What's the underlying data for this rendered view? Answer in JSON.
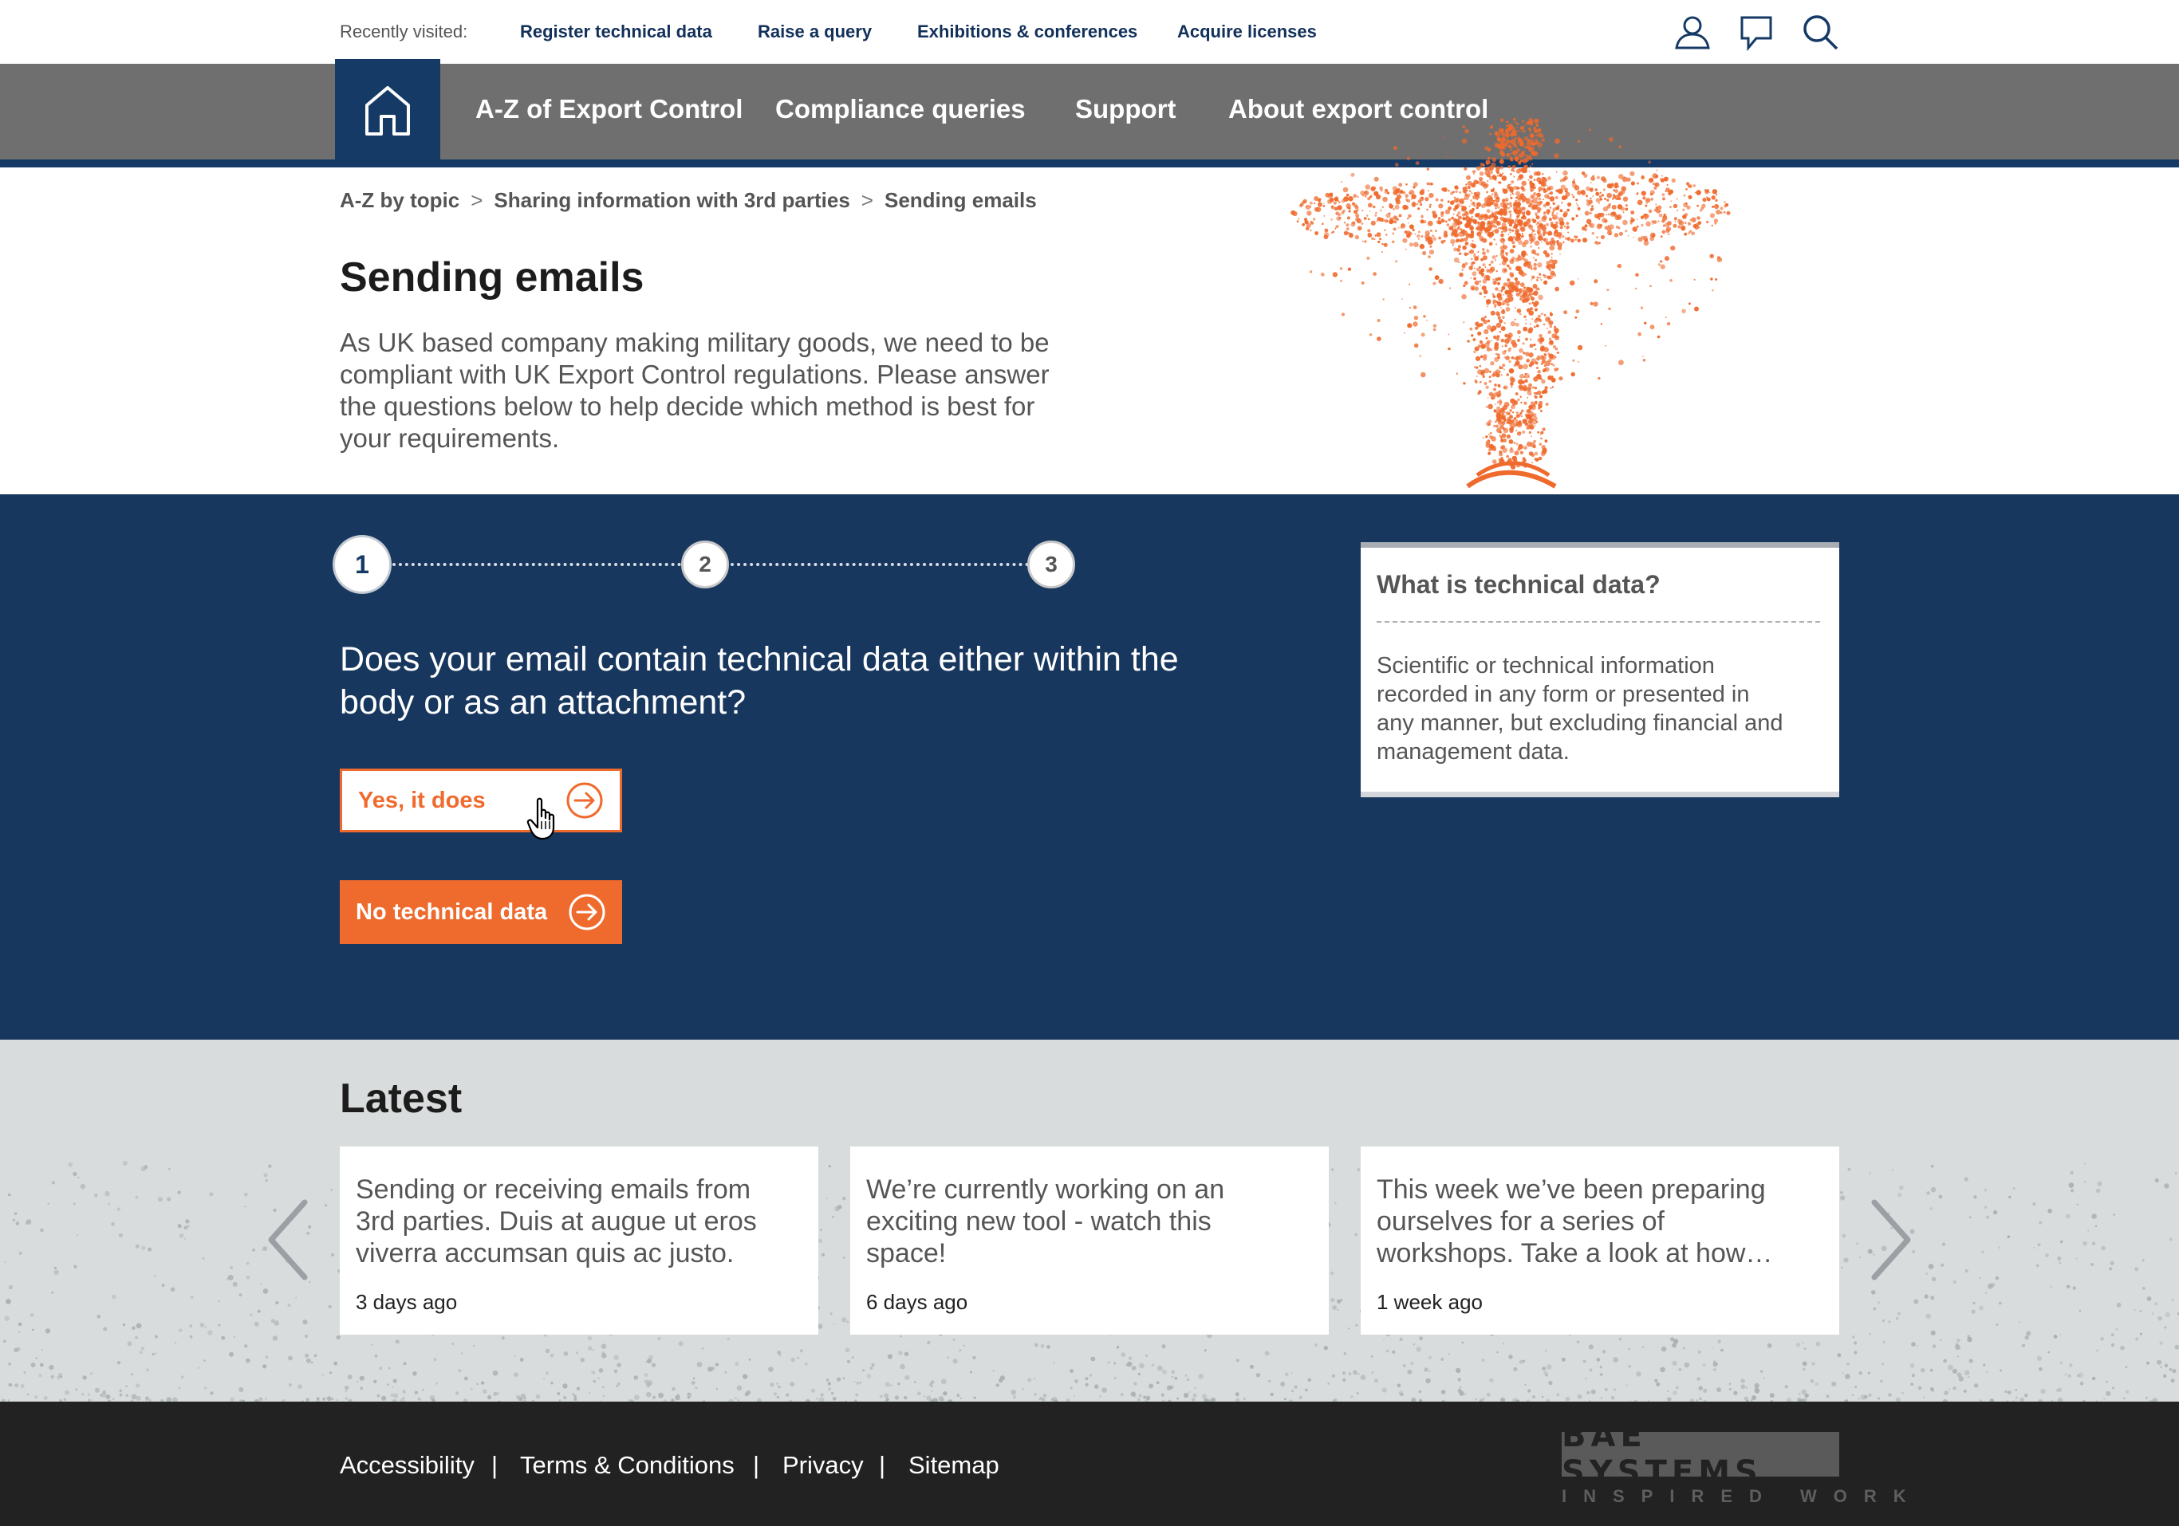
{
  "topbar": {
    "recently_visited_label": "Recently visited:",
    "links": [
      "Register technical data",
      "Raise a query",
      "Exhibitions & conferences",
      "Acquire licenses"
    ],
    "icons": [
      "user-icon",
      "feedback-icon",
      "search-icon"
    ]
  },
  "nav": {
    "home_icon": "home-icon",
    "items": [
      "A-Z of Export Control",
      "Compliance queries",
      "Support",
      "About export control"
    ]
  },
  "breadcrumb": {
    "items": [
      "A-Z by topic",
      "Sharing information with 3rd parties",
      "Sending emails"
    ],
    "separator": ">"
  },
  "hero": {
    "title": "Sending emails",
    "intro": "As UK based company making military goods, we need to be compliant with UK Export Control regulations. Please answer the questions below to help decide which method is best for your requirements."
  },
  "stepper": {
    "steps": [
      "1",
      "2",
      "3"
    ],
    "current_step": 1
  },
  "question": {
    "text": "Does your email contain technical data either within the body or as an attachment?",
    "answers": [
      "Yes, it does",
      "No technical data"
    ]
  },
  "info_card": {
    "title": "What is technical data?",
    "body": "Scientific or technical information recorded in any form or presented in any manner, but excluding financial and management data."
  },
  "latest": {
    "title": "Latest",
    "cards": [
      {
        "text": "Sending or receiving emails from 3rd parties. Duis at augue ut eros viverra accumsan quis ac justo.",
        "time": "3 days ago"
      },
      {
        "text": "We’re currently working on an exciting new tool - watch this space!",
        "time": "6 days ago"
      },
      {
        "text": "This week we’ve been preparing ourselves for a series of workshops. Take a look at how…",
        "time": "1 week ago"
      }
    ]
  },
  "footer": {
    "links": [
      "Accessibility",
      "Terms & Conditions",
      "Privacy",
      "Sitemap"
    ],
    "separator": "|",
    "brand_name": "BAE SYSTEMS",
    "brand_tagline": "INSPIRED WORK"
  },
  "colors": {
    "navy": "#17375e",
    "orange": "#ef6a2d",
    "nav_grey": "#6f6f6f",
    "footer_dark": "#222222",
    "latest_bg": "#d9dcdc"
  }
}
